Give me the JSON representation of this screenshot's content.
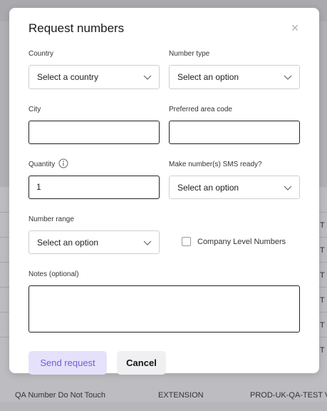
{
  "modal": {
    "title": "Request numbers",
    "close_icon": "close-icon",
    "fields": {
      "country": {
        "label": "Country",
        "value": "Select a country"
      },
      "number_type": {
        "label": "Number type",
        "value": "Select an option"
      },
      "city": {
        "label": "City",
        "value": ""
      },
      "preferred_area_code": {
        "label": "Preferred area code",
        "value": ""
      },
      "quantity": {
        "label": "Quantity",
        "value": "1"
      },
      "sms_ready": {
        "label": "Make number(s) SMS ready?",
        "value": "Select an option"
      },
      "number_range": {
        "label": "Number range",
        "value": "Select an option"
      },
      "company_level": {
        "label": "Company Level Numbers",
        "checked": false
      },
      "notes": {
        "label": "Notes (optional)",
        "value": ""
      }
    },
    "buttons": {
      "send": "Send request",
      "cancel": "Cancel"
    },
    "colors": {
      "send_bg": "#e6e1fb",
      "send_text": "#6f61d6"
    }
  },
  "background": {
    "rows": [
      {
        "c3": "T C"
      },
      {
        "c3": "T V"
      },
      {
        "c3": "T V"
      },
      {
        "c3": "T V"
      },
      {
        "c3": "T C"
      },
      {
        "c3": "T N"
      }
    ],
    "last_row": {
      "name": "QA Number Do Not Touch",
      "type": "EXTENSION",
      "env": "PROD-UK-QA-TEST V"
    }
  }
}
